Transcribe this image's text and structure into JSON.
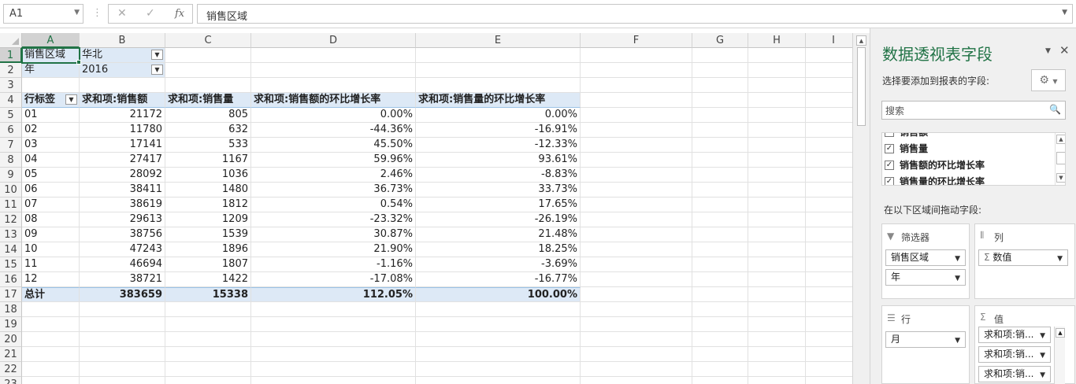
{
  "formula_bar": {
    "name_box": "A1",
    "cancel_symbol": "✕",
    "enter_symbol": "✓",
    "fx_label": "fx",
    "formula_content": "销售区域"
  },
  "columns": [
    "A",
    "B",
    "C",
    "D",
    "E",
    "F",
    "G",
    "H",
    "I"
  ],
  "rows": [
    "1",
    "2",
    "3",
    "4",
    "5",
    "6",
    "7",
    "8",
    "9",
    "10",
    "11",
    "12",
    "13",
    "14",
    "15",
    "16",
    "17",
    "18",
    "19",
    "20",
    "21",
    "22",
    "23"
  ],
  "report_filters": [
    {
      "field": "销售区域",
      "value": "华北"
    },
    {
      "field": "年",
      "value": "2016"
    }
  ],
  "pivot": {
    "headers": [
      "行标签",
      "求和项:销售额",
      "求和项:销售量",
      "求和项:销售额的环比增长率",
      "求和项:销售量的环比增长率"
    ],
    "rows": [
      [
        "01",
        "21172",
        "805",
        "0.00%",
        "0.00%"
      ],
      [
        "02",
        "11780",
        "632",
        "-44.36%",
        "-16.91%"
      ],
      [
        "03",
        "17141",
        "533",
        "45.50%",
        "-12.33%"
      ],
      [
        "04",
        "27417",
        "1167",
        "59.96%",
        "93.61%"
      ],
      [
        "05",
        "28092",
        "1036",
        "2.46%",
        "-8.83%"
      ],
      [
        "06",
        "38411",
        "1480",
        "36.73%",
        "33.73%"
      ],
      [
        "07",
        "38619",
        "1812",
        "0.54%",
        "17.65%"
      ],
      [
        "08",
        "29613",
        "1209",
        "-23.32%",
        "-26.19%"
      ],
      [
        "09",
        "38756",
        "1539",
        "30.87%",
        "21.48%"
      ],
      [
        "10",
        "47243",
        "1896",
        "21.90%",
        "18.25%"
      ],
      [
        "11",
        "46694",
        "1807",
        "-1.16%",
        "-3.69%"
      ],
      [
        "12",
        "38721",
        "1422",
        "-17.08%",
        "-16.77%"
      ]
    ],
    "total": [
      "总计",
      "383659",
      "15338",
      "112.05%",
      "100.00%"
    ]
  },
  "panel": {
    "title": "数据透视表字段",
    "subtitle": "选择要添加到报表的字段:",
    "search_placeholder": "搜索",
    "fields": [
      {
        "label": "销售额",
        "checked": true
      },
      {
        "label": "销售量",
        "checked": true
      },
      {
        "label": "销售额的环比增长率",
        "checked": true
      },
      {
        "label": "销售量的环比增长率",
        "checked": true
      }
    ],
    "drag_hint": "在以下区域间拖动字段:",
    "areas": {
      "filters": {
        "label": "筛选器",
        "items": [
          "销售区域",
          "年"
        ]
      },
      "columns": {
        "label": "列",
        "items": [
          "数值"
        ]
      },
      "rows": {
        "label": "行",
        "items": [
          "月"
        ]
      },
      "values": {
        "label": "值",
        "items": [
          "求和项:销...",
          "求和项:销...",
          "求和项:销..."
        ]
      }
    }
  },
  "colors": {
    "accent": "#217346",
    "pivot_fill": "#dde9f6"
  }
}
